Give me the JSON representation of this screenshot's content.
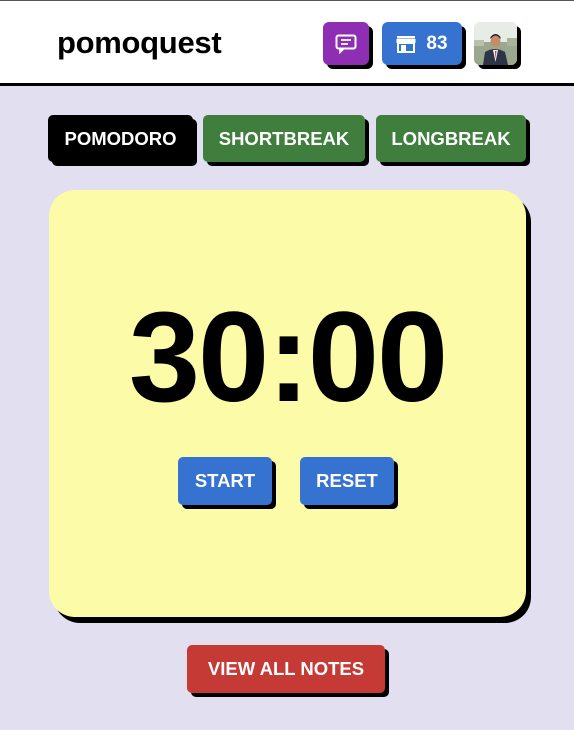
{
  "app": {
    "title": "pomoquest"
  },
  "header": {
    "notes_icon": "message-square-icon",
    "shop_icon": "store-icon",
    "coins": "83",
    "avatar": "user-avatar"
  },
  "modes": {
    "pomodoro": "POMODORO",
    "shortbreak": "SHORTBREAK",
    "longbreak": "LONGBREAK",
    "active": "POMODORO"
  },
  "timer": {
    "display": "30:00",
    "start_label": "START",
    "reset_label": "RESET"
  },
  "footer": {
    "view_notes_label": "VIEW ALL NOTES"
  },
  "colors": {
    "background": "#e1dff0",
    "card": "#fcfca8",
    "primary_blue": "#3672d0",
    "green": "#3f7e3c",
    "purple": "#8e2fb3",
    "red": "#c63a35"
  }
}
